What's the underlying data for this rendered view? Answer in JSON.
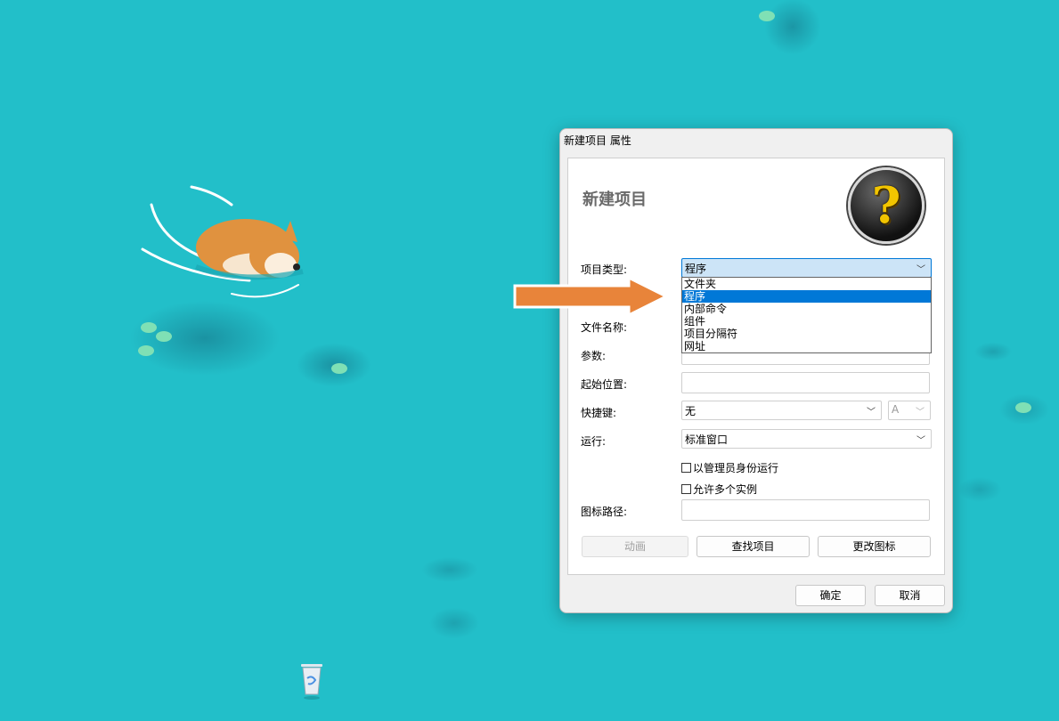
{
  "dialog": {
    "title": "新建项目 属性",
    "heading": "新建项目",
    "help_glyph": "?",
    "labels": {
      "item_type": "项目类型:",
      "file_name": "文件名称:",
      "params": "参数:",
      "start_location": "起始位置:",
      "shortcut": "快捷键:",
      "run": "运行:",
      "icon_path": "图标路径:"
    },
    "item_type": {
      "value": "程序",
      "options": [
        "文件夹",
        "程序",
        "内部命令",
        "组件",
        "项目分隔符",
        "网址"
      ],
      "selected_index": 1
    },
    "shortcut": {
      "value": "无",
      "key": "A"
    },
    "run": {
      "value": "标准窗口"
    },
    "checkboxes": {
      "run_as_admin": "以管理员身份运行",
      "allow_multiple": "允许多个实例"
    },
    "buttons": {
      "animate": "动画",
      "find_item": "查找项目",
      "change_icon": "更改图标",
      "ok": "确定",
      "cancel": "取消"
    }
  },
  "colors": {
    "desktop": "#22bfc9",
    "selection": "#0078d7",
    "arrow": "#e8843a"
  }
}
